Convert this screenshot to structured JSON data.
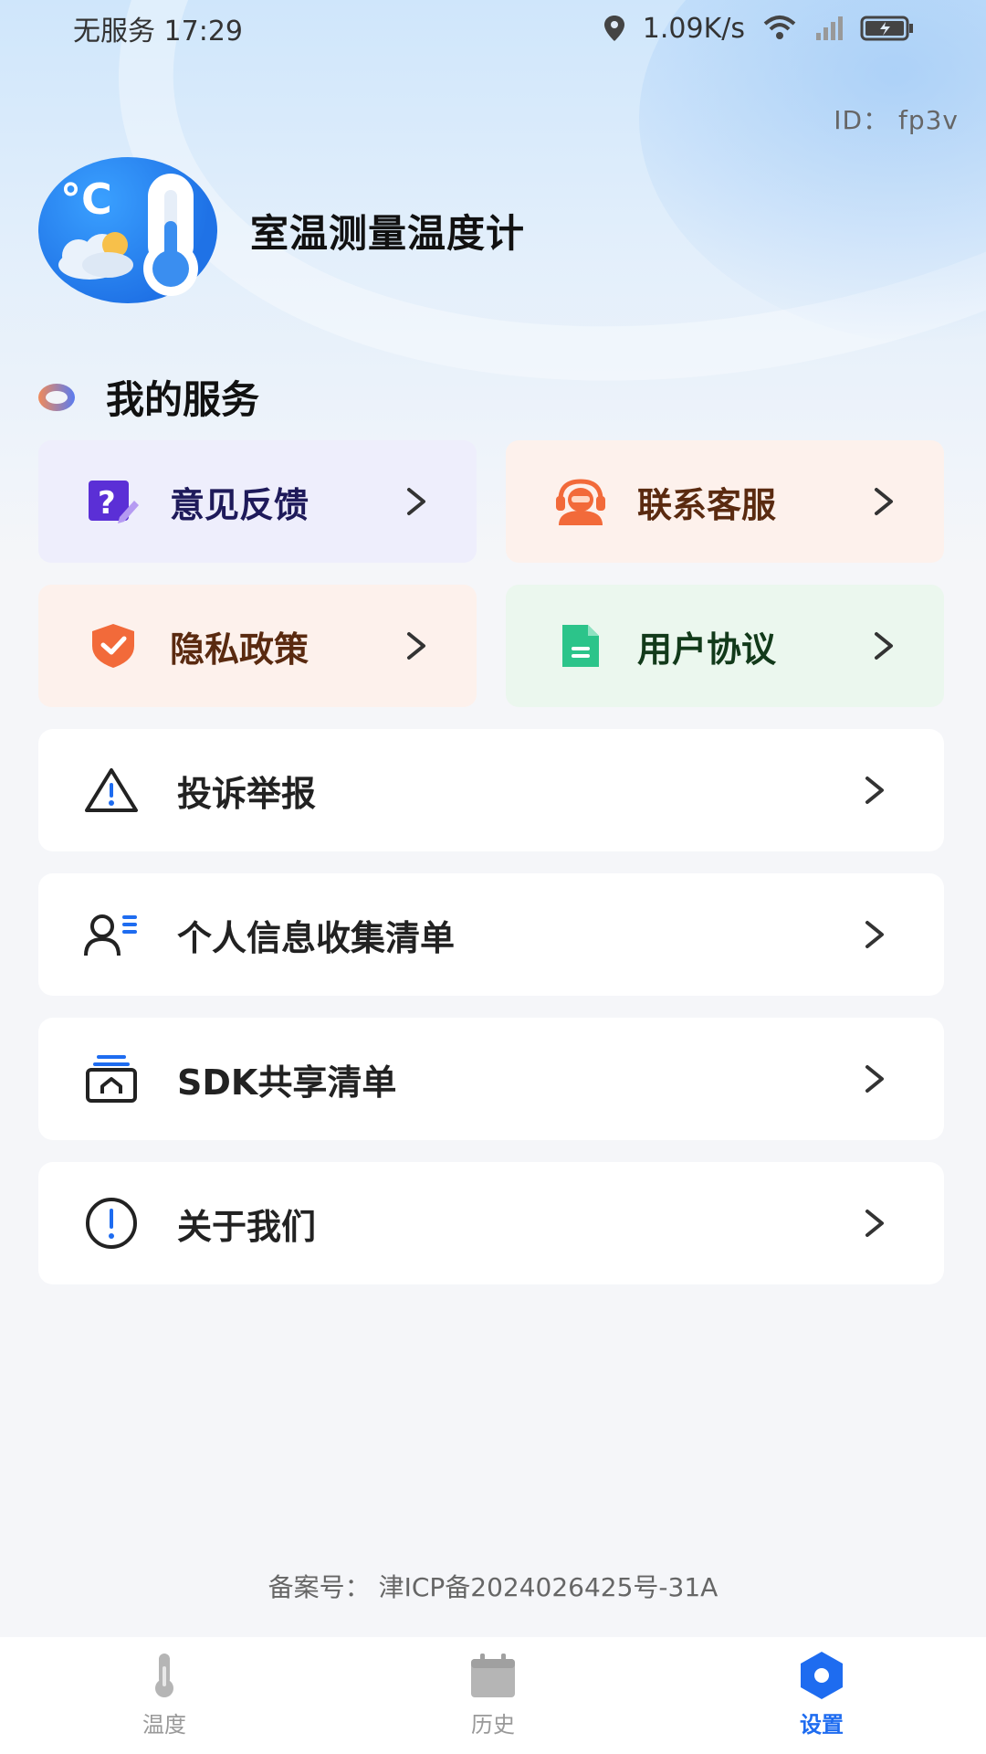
{
  "status_bar": {
    "carrier": "无服务",
    "time": "17:29",
    "speed": "1.09K/s"
  },
  "user": {
    "id_text": "ID：  fp3v"
  },
  "app": {
    "title": "室温测量温度计",
    "logo_text": "°C"
  },
  "section": {
    "title": "我的服务"
  },
  "cards": [
    {
      "label": "意见反馈",
      "icon": "feedback-icon",
      "color": "#5b2fd6"
    },
    {
      "label": "联系客服",
      "icon": "customer-service-icon",
      "color": "#f26a3a"
    },
    {
      "label": "隐私政策",
      "icon": "shield-icon",
      "color": "#f26a3a"
    },
    {
      "label": "用户协议",
      "icon": "document-icon",
      "color": "#2cc48a"
    }
  ],
  "list": [
    {
      "label": "投诉举报",
      "icon": "warning-icon"
    },
    {
      "label": "个人信息收集清单",
      "icon": "personal-info-icon"
    },
    {
      "label": "SDK共享清单",
      "icon": "sdk-share-icon"
    },
    {
      "label": "关于我们",
      "icon": "info-icon"
    }
  ],
  "footer": {
    "icp": "备案号：  津ICP备2024026425号-31A"
  },
  "tabbar": {
    "tabs": [
      {
        "label": "温度",
        "icon": "thermometer-icon"
      },
      {
        "label": "历史",
        "icon": "calendar-icon"
      },
      {
        "label": "设置",
        "icon": "settings-icon",
        "active": true
      }
    ],
    "active_color": "#1e6cf0"
  }
}
